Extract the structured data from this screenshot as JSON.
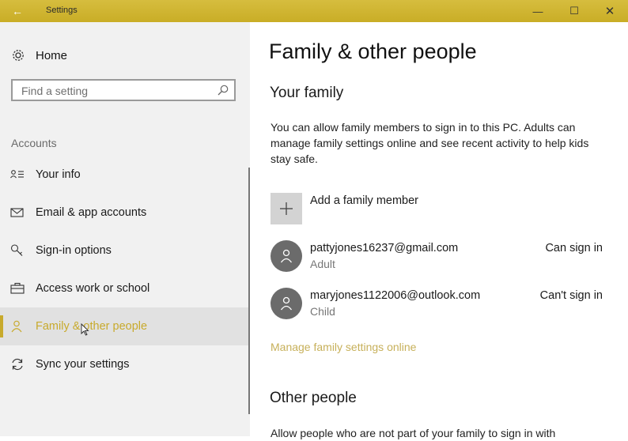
{
  "window": {
    "title": "Settings",
    "back_glyph": "←",
    "minimize_glyph": "—",
    "maximize_glyph": "☐",
    "close_glyph": "✕",
    "accent": "#c8aa2c"
  },
  "sidebar": {
    "home_label": "Home",
    "search_placeholder": "Find a setting",
    "section_label": "Accounts",
    "items": [
      {
        "label": "Your info",
        "icon": "contact-card-icon"
      },
      {
        "label": "Email & app accounts",
        "icon": "envelope-icon"
      },
      {
        "label": "Sign-in options",
        "icon": "key-icon"
      },
      {
        "label": "Access work or school",
        "icon": "briefcase-icon"
      },
      {
        "label": "Family & other people",
        "icon": "person-icon",
        "selected": true
      },
      {
        "label": "Sync your settings",
        "icon": "sync-icon"
      }
    ]
  },
  "main": {
    "title": "Family & other people",
    "your_family": {
      "heading": "Your family",
      "description": "You can allow family members to sign in to this PC. Adults can manage family settings online and see recent activity to help kids stay safe.",
      "add_label": "Add a family member",
      "members": [
        {
          "email": "pattyjones16237@gmail.com",
          "role": "Adult",
          "status": "Can sign in"
        },
        {
          "email": "maryjones1122006@outlook.com",
          "role": "Child",
          "status": "Can't sign in"
        }
      ],
      "manage_link": "Manage family settings online"
    },
    "other_people": {
      "heading": "Other people",
      "description": "Allow people who are not part of your family to sign in with"
    }
  }
}
